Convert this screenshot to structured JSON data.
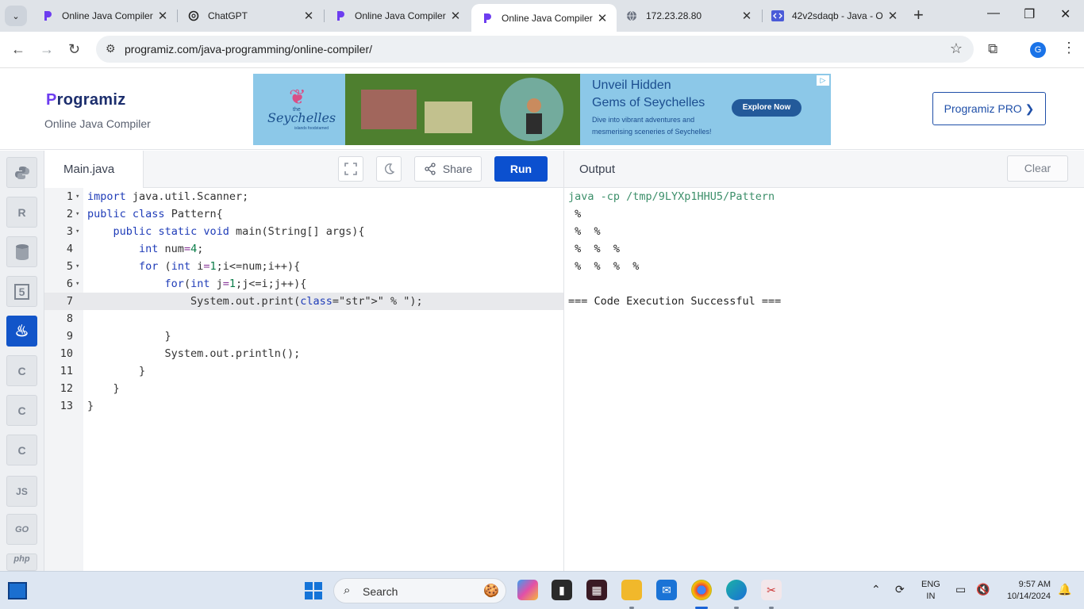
{
  "browser": {
    "tabs": [
      {
        "title": "Online Java Compiler",
        "icon": "programiz-icon",
        "active": false
      },
      {
        "title": "ChatGPT",
        "icon": "chatgpt-icon",
        "active": false
      },
      {
        "title": "Online Java Compiler",
        "icon": "programiz-icon",
        "active": false
      },
      {
        "title": "Online Java Compiler",
        "icon": "programiz-icon",
        "active": true
      },
      {
        "title": "172.23.28.80",
        "icon": "globe-icon",
        "active": false
      },
      {
        "title": "42v2sdaqb - Java - O",
        "icon": "code-icon",
        "active": false
      }
    ],
    "url": "programiz.com/java-programming/online-compiler/",
    "profile_initial": "G"
  },
  "site": {
    "logo_p": "P",
    "logo_rest": "rogramiz",
    "subtitle": "Online Java Compiler",
    "pro_button": "Programiz PRO ❯"
  },
  "ad": {
    "brand_small": "the",
    "brand": "Seychelles",
    "brand_tagline": "islands foodstamed",
    "headline1": "Unveil Hidden",
    "headline2": "Gems of Seychelles",
    "copy1": "Dive into vibrant adventures and",
    "copy2": "mesmerising sceneries of Seychelles!",
    "cta": "Explore Now"
  },
  "rail": {
    "items": [
      {
        "name": "python",
        "icon": "python-icon",
        "label": "",
        "active": false
      },
      {
        "name": "r",
        "icon": "r-icon",
        "label": "R",
        "active": false
      },
      {
        "name": "sql",
        "icon": "database-icon",
        "label": "",
        "active": false
      },
      {
        "name": "html",
        "icon": "html5-icon",
        "label": "5",
        "active": false
      },
      {
        "name": "java",
        "icon": "java-icon",
        "label": "♨",
        "active": true
      },
      {
        "name": "c",
        "icon": "c-icon",
        "label": "C",
        "active": false
      },
      {
        "name": "cpp",
        "icon": "cpp-icon",
        "label": "C",
        "active": false
      },
      {
        "name": "csharp",
        "icon": "csharp-icon",
        "label": "C",
        "active": false
      },
      {
        "name": "js",
        "icon": "js-icon",
        "label": "JS",
        "active": false
      },
      {
        "name": "go",
        "icon": "go-icon",
        "label": "GO",
        "active": false
      },
      {
        "name": "php",
        "icon": "php-icon",
        "label": "php",
        "active": false
      }
    ]
  },
  "editor": {
    "file_name": "Main.java",
    "share_label": "Share",
    "run_label": "Run",
    "active_line": 7,
    "lines": [
      {
        "n": "1",
        "fold": true,
        "code": "import java.util.Scanner;"
      },
      {
        "n": "2",
        "fold": true,
        "code": "public class Pattern{"
      },
      {
        "n": "3",
        "fold": true,
        "code": "    public static void main(String[] args){"
      },
      {
        "n": "4",
        "fold": false,
        "code": "        int num=4;"
      },
      {
        "n": "5",
        "fold": true,
        "code": "        for (int i=1;i<=num;i++){"
      },
      {
        "n": "6",
        "fold": true,
        "code": "            for(int j=1;j<=i;j++){"
      },
      {
        "n": "7",
        "fold": false,
        "code": "                System.out.print(\" % \");"
      },
      {
        "n": "8",
        "fold": false,
        "code": ""
      },
      {
        "n": "9",
        "fold": false,
        "code": "            }"
      },
      {
        "n": "10",
        "fold": false,
        "code": "            System.out.println();"
      },
      {
        "n": "11",
        "fold": false,
        "code": "        }"
      },
      {
        "n": "12",
        "fold": false,
        "code": "    }"
      },
      {
        "n": "13",
        "fold": false,
        "code": "}"
      }
    ]
  },
  "output": {
    "title": "Output",
    "clear_label": "Clear",
    "lines": [
      "java -cp /tmp/9LYXp1HHU5/Pattern",
      " % ",
      " %  % ",
      " %  %  % ",
      " %  %  %  % ",
      "",
      "=== Code Execution Successful ==="
    ]
  },
  "taskbar": {
    "search_label": "Search",
    "lang_line1": "ENG",
    "lang_line2": "IN",
    "time": "9:57 AM",
    "date": "10/14/2024"
  },
  "colors": {
    "run_button": "#0b50cf",
    "active_rail": "#1255c9",
    "logo_navy": "#1c2e6d",
    "logo_purple": "#6d3df0"
  }
}
